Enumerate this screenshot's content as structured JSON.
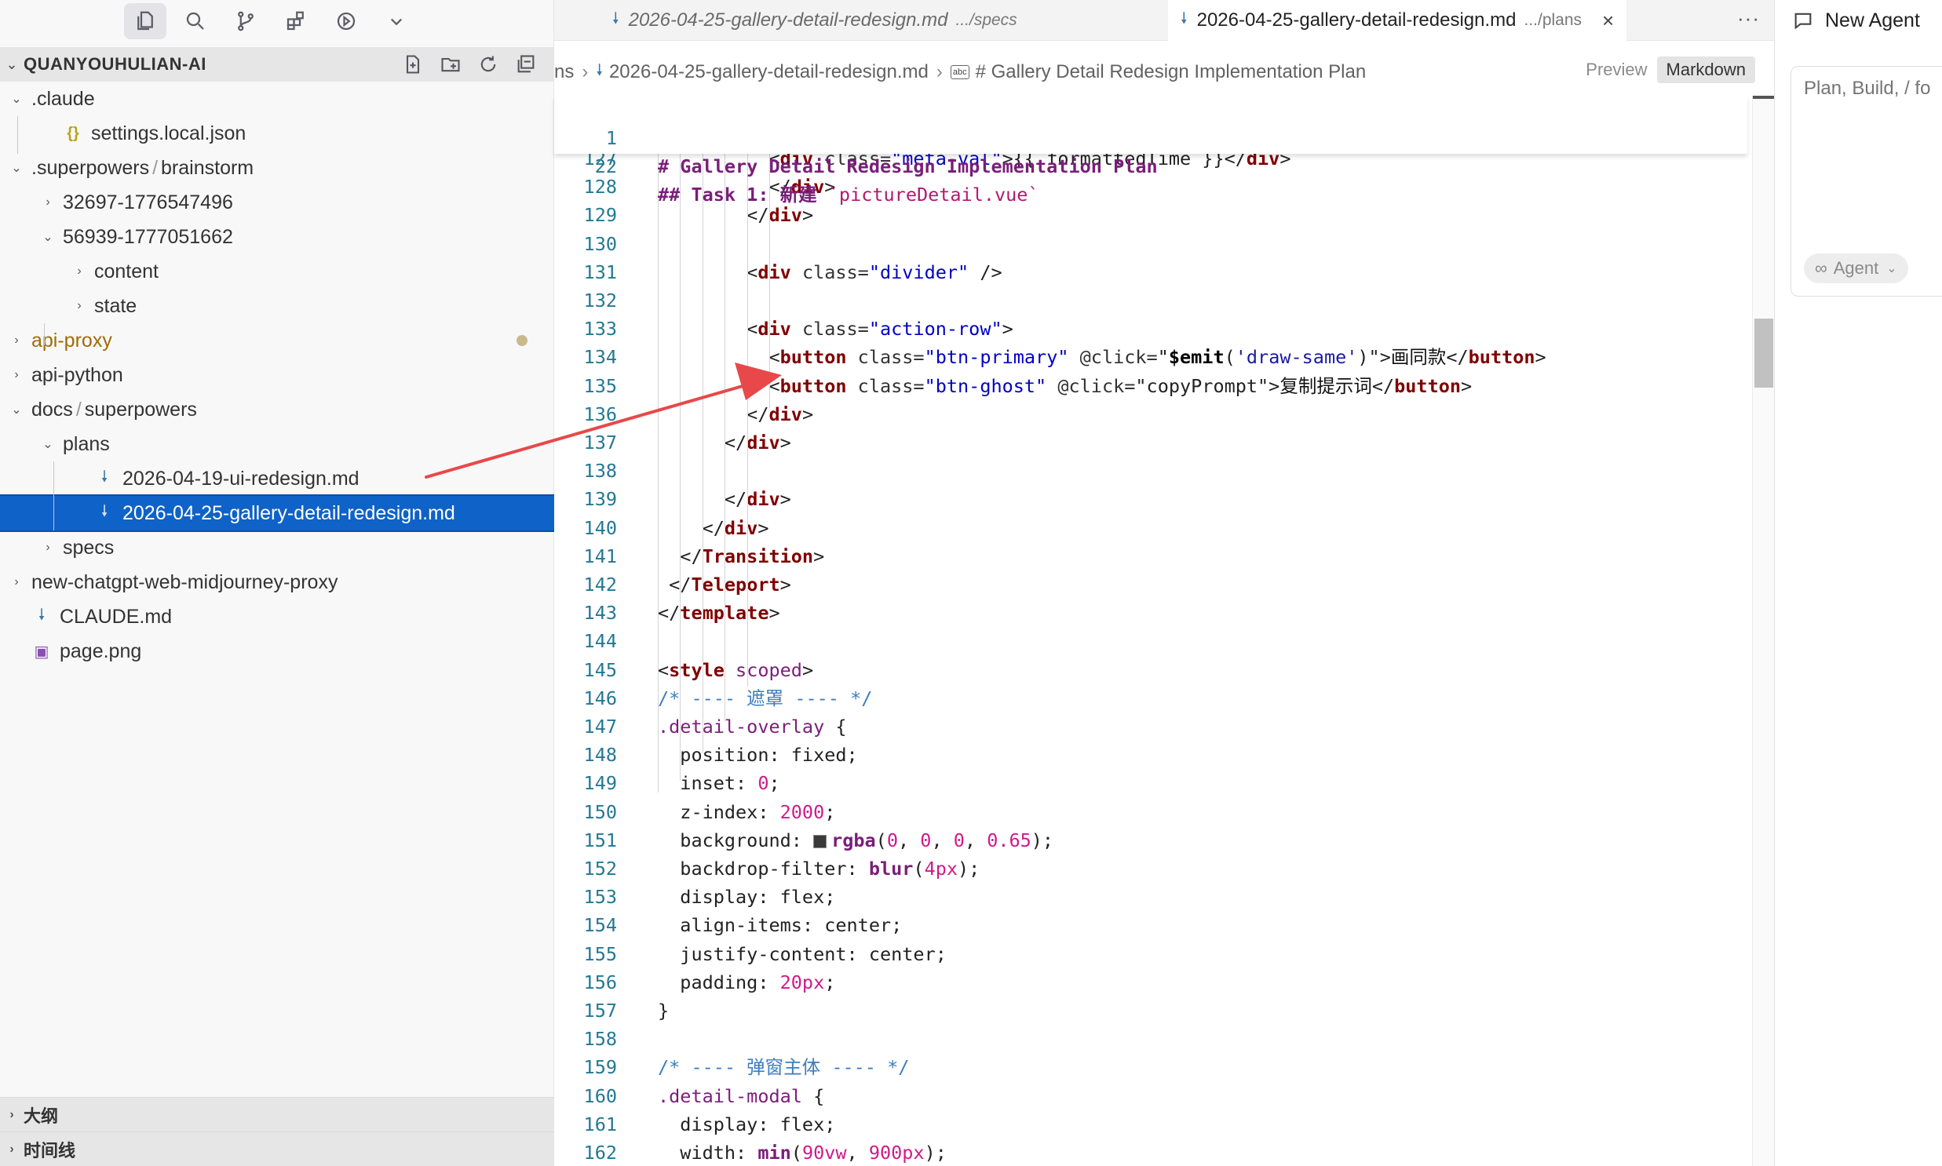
{
  "sidebar": {
    "explorer_title": "QUANYOUHULIAN-AI",
    "tree": [
      {
        "label": ".claude",
        "twisty": "open",
        "icon": "none"
      },
      {
        "label": "settings.local.json",
        "twisty": "none",
        "icon": "json-icon",
        "icon_glyph": "{}"
      },
      {
        "label": ".superpowers",
        "label2": "brainstorm",
        "twisty": "open",
        "icon": "none"
      },
      {
        "label": "32697-1776547496",
        "twisty": "closed",
        "icon": "none"
      },
      {
        "label": "56939-1777051662",
        "twisty": "open",
        "icon": "none"
      },
      {
        "label": "content",
        "twisty": "closed",
        "icon": "none"
      },
      {
        "label": "state",
        "twisty": "closed",
        "icon": "none"
      },
      {
        "label": "api-proxy",
        "twisty": "closed",
        "icon": "none",
        "modified": true
      },
      {
        "label": "api-python",
        "twisty": "closed",
        "icon": "none"
      },
      {
        "label": "docs",
        "label2": "superpowers",
        "twisty": "open",
        "icon": "none"
      },
      {
        "label": "plans",
        "twisty": "open",
        "icon": "none"
      },
      {
        "label": "2026-04-19-ui-redesign.md",
        "twisty": "none",
        "icon": "markdown-icon"
      },
      {
        "label": "2026-04-25-gallery-detail-redesign.md",
        "twisty": "none",
        "icon": "markdown-icon",
        "selected": true
      },
      {
        "label": "specs",
        "twisty": "closed",
        "icon": "none"
      },
      {
        "label": "new-chatgpt-web-midjourney-proxy",
        "twisty": "closed",
        "icon": "none"
      },
      {
        "label": "CLAUDE.md",
        "twisty": "none",
        "icon": "markdown-icon"
      },
      {
        "label": "page.png",
        "twisty": "none",
        "icon": "image-icon"
      }
    ],
    "outline_label": "大纲",
    "timeline_label": "时间线",
    "path_separator": "/"
  },
  "tabs": [
    {
      "label": "2026-04-25-gallery-detail-redesign.md",
      "desc": ".../specs",
      "active": false
    },
    {
      "label": "2026-04-25-gallery-detail-redesign.md",
      "desc": ".../plans",
      "active": true,
      "close": "×"
    }
  ],
  "more_label": "···",
  "breadcrumb": {
    "lead": "ns",
    "file": "2026-04-25-gallery-detail-redesign.md",
    "abc_badge": "abc",
    "symbol": "# Gallery Detail Redesign Implementation Plan",
    "sep": "›"
  },
  "mode_switch": {
    "preview": "Preview",
    "markdown": "Markdown"
  },
  "sticky_lines": [
    {
      "num": "1",
      "text": "# Gallery Detail Redesign Implementation Plan"
    },
    {
      "num": "22",
      "text": "## Task 1: 新建 ",
      "code": "`pictureDetail.vue`"
    }
  ],
  "code_lines": [
    {
      "num": "127",
      "segments": [
        [
          "t-punc",
          "          <"
        ],
        [
          "t-tag",
          "div"
        ],
        [
          "t-attr",
          " class="
        ],
        [
          "t-str",
          "\"meta-val\""
        ],
        [
          "t-punc",
          ">{{ formattedTime }}</"
        ],
        [
          "t-tag",
          "div"
        ],
        [
          "t-punc",
          ">"
        ]
      ]
    },
    {
      "num": "128",
      "segments": [
        [
          "t-punc",
          "          </"
        ],
        [
          "t-tag",
          "div"
        ],
        [
          "t-punc",
          ">"
        ]
      ]
    },
    {
      "num": "129",
      "segments": [
        [
          "t-punc",
          "        </"
        ],
        [
          "t-tag",
          "div"
        ],
        [
          "t-punc",
          ">"
        ]
      ]
    },
    {
      "num": "130",
      "segments": []
    },
    {
      "num": "131",
      "segments": [
        [
          "t-punc",
          "        <"
        ],
        [
          "t-tag",
          "div"
        ],
        [
          "t-attr",
          " class="
        ],
        [
          "t-str",
          "\"divider\""
        ],
        [
          "t-punc",
          " />"
        ]
      ]
    },
    {
      "num": "132",
      "segments": []
    },
    {
      "num": "133",
      "segments": [
        [
          "t-punc",
          "        <"
        ],
        [
          "t-tag",
          "div"
        ],
        [
          "t-attr",
          " class="
        ],
        [
          "t-str",
          "\"action-row\""
        ],
        [
          "t-punc",
          ">"
        ]
      ]
    },
    {
      "num": "134",
      "segments": [
        [
          "t-punc",
          "          <"
        ],
        [
          "t-tag",
          "button"
        ],
        [
          "t-attr",
          " class="
        ],
        [
          "t-str",
          "\"btn-primary\""
        ],
        [
          "t-attr",
          " @click="
        ],
        [
          "t-punc",
          "\""
        ],
        [
          "t-fn",
          "$emit"
        ],
        [
          "t-punc",
          "("
        ],
        [
          "t-strl",
          "'draw-same'"
        ],
        [
          "t-punc",
          ")\">"
        ],
        [
          "t-txt",
          "画同款"
        ],
        [
          "t-punc",
          "</"
        ],
        [
          "t-tag",
          "button"
        ],
        [
          "t-punc",
          ">"
        ]
      ]
    },
    {
      "num": "135",
      "segments": [
        [
          "t-punc",
          "          <"
        ],
        [
          "t-tag",
          "button"
        ],
        [
          "t-attr",
          " class="
        ],
        [
          "t-str",
          "\"btn-ghost\""
        ],
        [
          "t-attr",
          " @click="
        ],
        [
          "t-punc",
          "\"copyPrompt\">"
        ],
        [
          "t-txt",
          "复制提示词"
        ],
        [
          "t-punc",
          "</"
        ],
        [
          "t-tag",
          "button"
        ],
        [
          "t-punc",
          ">"
        ]
      ]
    },
    {
      "num": "136",
      "segments": [
        [
          "t-punc",
          "        </"
        ],
        [
          "t-tag",
          "div"
        ],
        [
          "t-punc",
          ">"
        ]
      ]
    },
    {
      "num": "137",
      "segments": [
        [
          "t-punc",
          "      </"
        ],
        [
          "t-tag",
          "div"
        ],
        [
          "t-punc",
          ">"
        ]
      ]
    },
    {
      "num": "138",
      "segments": []
    },
    {
      "num": "139",
      "segments": [
        [
          "t-punc",
          "      </"
        ],
        [
          "t-tag",
          "div"
        ],
        [
          "t-punc",
          ">"
        ]
      ]
    },
    {
      "num": "140",
      "segments": [
        [
          "t-punc",
          "    </"
        ],
        [
          "t-tag",
          "div"
        ],
        [
          "t-punc",
          ">"
        ]
      ]
    },
    {
      "num": "141",
      "segments": [
        [
          "t-punc",
          "  </"
        ],
        [
          "t-tag",
          "Transition"
        ],
        [
          "t-punc",
          ">"
        ]
      ]
    },
    {
      "num": "142",
      "segments": [
        [
          "t-punc",
          " </"
        ],
        [
          "t-tag",
          "Teleport"
        ],
        [
          "t-punc",
          ">"
        ]
      ]
    },
    {
      "num": "143",
      "segments": [
        [
          "t-punc",
          "</"
        ],
        [
          "t-tag",
          "template"
        ],
        [
          "t-punc",
          ">"
        ]
      ]
    },
    {
      "num": "144",
      "segments": []
    },
    {
      "num": "145",
      "segments": [
        [
          "t-punc",
          "<"
        ],
        [
          "t-tag",
          "style"
        ],
        [
          "t-sel",
          " scoped"
        ],
        [
          "t-punc",
          ">"
        ]
      ]
    },
    {
      "num": "146",
      "segments": [
        [
          "t-cmt",
          "/* ---- 遮罩 ---- */"
        ]
      ]
    },
    {
      "num": "147",
      "segments": [
        [
          "t-sel",
          ".detail-overlay"
        ],
        [
          "t-punc",
          " {"
        ]
      ]
    },
    {
      "num": "148",
      "segments": [
        [
          "t-prop",
          "  position"
        ],
        [
          "t-punc",
          ": "
        ],
        [
          "t-prop",
          "fixed"
        ],
        [
          "t-punc",
          ";"
        ]
      ]
    },
    {
      "num": "149",
      "segments": [
        [
          "t-prop",
          "  inset"
        ],
        [
          "t-punc",
          ": "
        ],
        [
          "t-num",
          "0"
        ],
        [
          "t-punc",
          ";"
        ]
      ]
    },
    {
      "num": "150",
      "segments": [
        [
          "t-prop",
          "  z-index"
        ],
        [
          "t-punc",
          ": "
        ],
        [
          "t-num",
          "2000"
        ],
        [
          "t-punc",
          ";"
        ]
      ]
    },
    {
      "num": "151",
      "segments": [
        [
          "t-prop",
          "  background"
        ],
        [
          "t-punc",
          ": "
        ],
        [
          "swatch",
          ""
        ],
        [
          "t-kw",
          "rgba"
        ],
        [
          "t-punc",
          "("
        ],
        [
          "t-num",
          "0"
        ],
        [
          "t-punc",
          ", "
        ],
        [
          "t-num",
          "0"
        ],
        [
          "t-punc",
          ", "
        ],
        [
          "t-num",
          "0"
        ],
        [
          "t-punc",
          ", "
        ],
        [
          "t-num",
          "0.65"
        ],
        [
          "t-punc",
          ");"
        ]
      ]
    },
    {
      "num": "152",
      "segments": [
        [
          "t-prop",
          "  backdrop-filter"
        ],
        [
          "t-punc",
          ": "
        ],
        [
          "t-kw",
          "blur"
        ],
        [
          "t-punc",
          "("
        ],
        [
          "t-num",
          "4px"
        ],
        [
          "t-punc",
          ");"
        ]
      ]
    },
    {
      "num": "153",
      "segments": [
        [
          "t-prop",
          "  display"
        ],
        [
          "t-punc",
          ": "
        ],
        [
          "t-prop",
          "flex"
        ],
        [
          "t-punc",
          ";"
        ]
      ]
    },
    {
      "num": "154",
      "segments": [
        [
          "t-prop",
          "  align-items"
        ],
        [
          "t-punc",
          ": "
        ],
        [
          "t-prop",
          "center"
        ],
        [
          "t-punc",
          ";"
        ]
      ]
    },
    {
      "num": "155",
      "segments": [
        [
          "t-prop",
          "  justify-content"
        ],
        [
          "t-punc",
          ": "
        ],
        [
          "t-prop",
          "center"
        ],
        [
          "t-punc",
          ";"
        ]
      ]
    },
    {
      "num": "156",
      "segments": [
        [
          "t-prop",
          "  padding"
        ],
        [
          "t-punc",
          ": "
        ],
        [
          "t-num",
          "20px"
        ],
        [
          "t-punc",
          ";"
        ]
      ]
    },
    {
      "num": "157",
      "segments": [
        [
          "t-punc",
          "}"
        ]
      ]
    },
    {
      "num": "158",
      "segments": []
    },
    {
      "num": "159",
      "segments": [
        [
          "t-cmt",
          "/* ---- 弹窗主体 ---- */"
        ]
      ]
    },
    {
      "num": "160",
      "segments": [
        [
          "t-sel",
          ".detail-modal"
        ],
        [
          "t-punc",
          " {"
        ]
      ]
    },
    {
      "num": "161",
      "segments": [
        [
          "t-prop",
          "  display"
        ],
        [
          "t-punc",
          ": "
        ],
        [
          "t-prop",
          "flex"
        ],
        [
          "t-punc",
          ";"
        ]
      ]
    },
    {
      "num": "162",
      "segments": [
        [
          "t-prop",
          "  width"
        ],
        [
          "t-punc",
          ": "
        ],
        [
          "t-kw",
          "min"
        ],
        [
          "t-punc",
          "("
        ],
        [
          "t-num",
          "90vw"
        ],
        [
          "t-punc",
          ", "
        ],
        [
          "t-num",
          "900px"
        ],
        [
          "t-punc",
          ");"
        ]
      ]
    }
  ],
  "agent": {
    "title": "New Agent",
    "placeholder": "Plan, Build, / fo",
    "mode_label": "Agent",
    "mode_icon": "∞"
  },
  "colors": {
    "selection": "#0f62c7",
    "annotation_arrow": "#e8484a",
    "line_number": "#237893"
  }
}
